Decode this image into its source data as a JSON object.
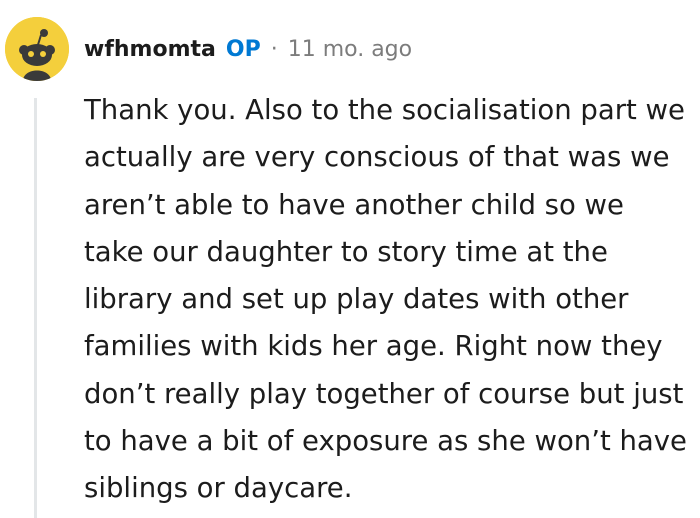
{
  "comment": {
    "username": "wfhmomta",
    "op_badge": "OP",
    "separator": "·",
    "timestamp": "11 mo. ago",
    "body": "Thank you. Also to the socialisation part we actually are very conscious of that was we aren’t able to have another child so we take our daughter to story time at the library and set up play dates with other families with kids her age. Right now they don’t really play together of course but just to have a bit of exposure as she won’t have siblings or daycare.",
    "avatar_icon": "snoo-avatar-icon"
  },
  "colors": {
    "avatar_bg": "#f4cf3c",
    "op_badge": "#0079d3",
    "meta_text": "#7c7c7c",
    "thread_line": "#e3e6e8",
    "text": "#1c1c1c"
  }
}
